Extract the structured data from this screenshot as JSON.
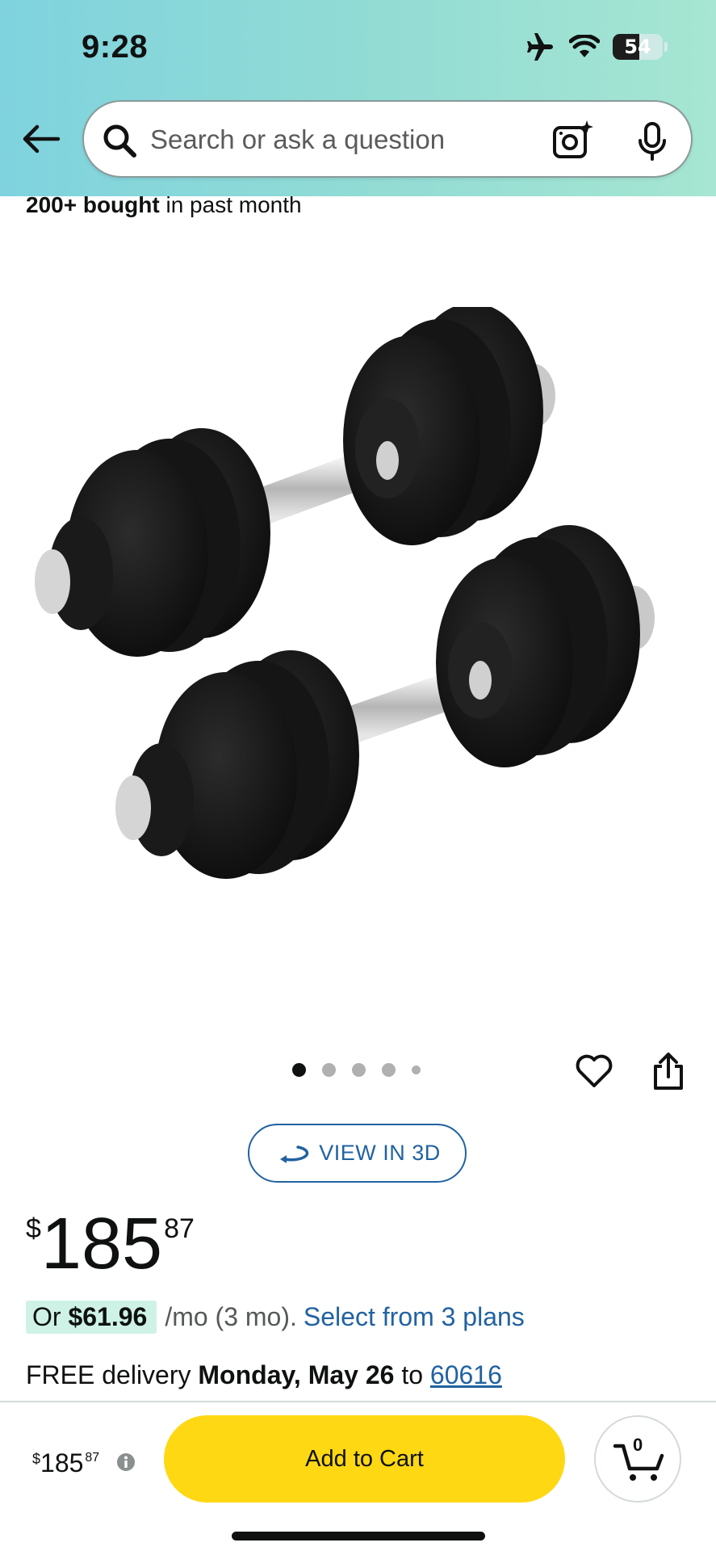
{
  "status_bar": {
    "time": "9:28",
    "battery": "54",
    "battery_level_percent": 54,
    "icons": [
      "airplane-icon",
      "wifi-icon",
      "battery-icon"
    ]
  },
  "header": {
    "search_placeholder": "Search or ask a question",
    "icons": [
      "back-arrow-icon",
      "search-icon",
      "camera-icon",
      "microphone-icon"
    ]
  },
  "product": {
    "bought_count": "200+ bought",
    "bought_suffix": " in past month",
    "image_count": 5,
    "active_image_index": 0,
    "view_3d_label": "VIEW IN 3D",
    "price": {
      "symbol": "$",
      "whole": "185",
      "fraction": "87"
    },
    "installment": {
      "prefix": "Or ",
      "amount": "$61.96",
      "terms": "/mo (3 mo).",
      "link": "Select from 3 plans"
    },
    "delivery": {
      "prefix": "FREE delivery ",
      "date": "Monday, May 26",
      "middle": " to ",
      "zip": "60616"
    }
  },
  "bottom_bar": {
    "price": {
      "symbol": "$",
      "whole": "185",
      "fraction": "87"
    },
    "add_to_cart_label": "Add to Cart",
    "cart_count": "0"
  },
  "colors": {
    "accent_link": "#2162a1",
    "cart_button": "#ffd814",
    "installment_highlight": "#cef3e6",
    "header_gradient_start": "#7fd3de",
    "header_gradient_end": "#a6e6d2"
  }
}
